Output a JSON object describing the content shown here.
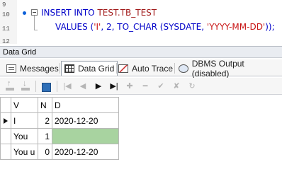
{
  "editor": {
    "line_numbers": [
      "9",
      "10",
      "11",
      "12"
    ],
    "line1_keyword": "INSERT INTO ",
    "line1_table": "TEST.TB_TEST",
    "line2_prefix": "VALUES (",
    "line2_str1": "'I'",
    "line2_mid": ", 2, TO_CHAR (SYSDATE, ",
    "line2_str2": "'YYYY-MM-DD'",
    "line2_suffix": "));"
  },
  "panel": {
    "title": "Data Grid",
    "tabs": [
      {
        "label": "Messages",
        "icon": "messages-icon"
      },
      {
        "label": "Data Grid",
        "icon": "data-grid-icon"
      },
      {
        "label": "Auto Trace",
        "icon": "auto-trace-icon"
      },
      {
        "label": "DBMS Output (disabled)",
        "icon": "dbms-output-icon"
      }
    ],
    "active_tab": "Data Grid"
  },
  "toolbar": {
    "nav_glyphs": {
      "first": "|◀",
      "prev": "◀",
      "next": "▶",
      "last": "▶|",
      "insert": "✚",
      "delete": "━",
      "post": "✔",
      "cancel": "✘",
      "refresh": "↻"
    }
  },
  "grid": {
    "columns": [
      "V",
      "N",
      "D"
    ],
    "rows": [
      {
        "V": "I",
        "N": "2",
        "D": "2020-12-20",
        "current": true
      },
      {
        "V": "You",
        "N": "1",
        "D": "",
        "d_null": true
      },
      {
        "V": "You u",
        "N": "0",
        "D": "2020-12-20"
      }
    ],
    "null_cell_color": "#a8d3a0"
  }
}
